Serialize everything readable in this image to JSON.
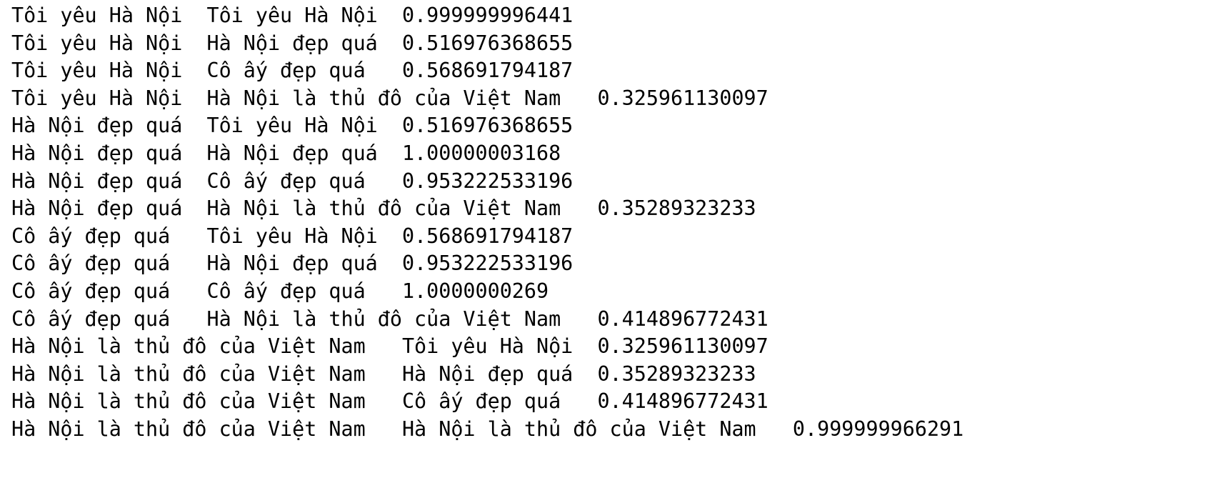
{
  "output": {
    "lines": [
      "Tôi yêu Hà Nội  Tôi yêu Hà Nội  0.999999996441",
      "Tôi yêu Hà Nội  Hà Nội đẹp quá  0.516976368655",
      "Tôi yêu Hà Nội  Cô ấy đẹp quá   0.568691794187",
      "Tôi yêu Hà Nội  Hà Nội là thủ đô của Việt Nam   0.325961130097",
      "Hà Nội đẹp quá  Tôi yêu Hà Nội  0.516976368655",
      "Hà Nội đẹp quá  Hà Nội đẹp quá  1.00000003168",
      "Hà Nội đẹp quá  Cô ấy đẹp quá   0.953222533196",
      "Hà Nội đẹp quá  Hà Nội là thủ đô của Việt Nam   0.35289323233",
      "Cô ấy đẹp quá   Tôi yêu Hà Nội  0.568691794187",
      "Cô ấy đẹp quá   Hà Nội đẹp quá  0.953222533196",
      "Cô ấy đẹp quá   Cô ấy đẹp quá   1.0000000269",
      "Cô ấy đẹp quá   Hà Nội là thủ đô của Việt Nam   0.414896772431",
      "Hà Nội là thủ đô của Việt Nam   Tôi yêu Hà Nội  0.325961130097",
      "Hà Nội là thủ đô của Việt Nam   Hà Nội đẹp quá  0.35289323233",
      "Hà Nội là thủ đô của Việt Nam   Cô ấy đẹp quá   0.414896772431",
      "Hà Nội là thủ đô của Việt Nam   Hà Nội là thủ đô của Việt Nam   0.999999966291"
    ]
  }
}
